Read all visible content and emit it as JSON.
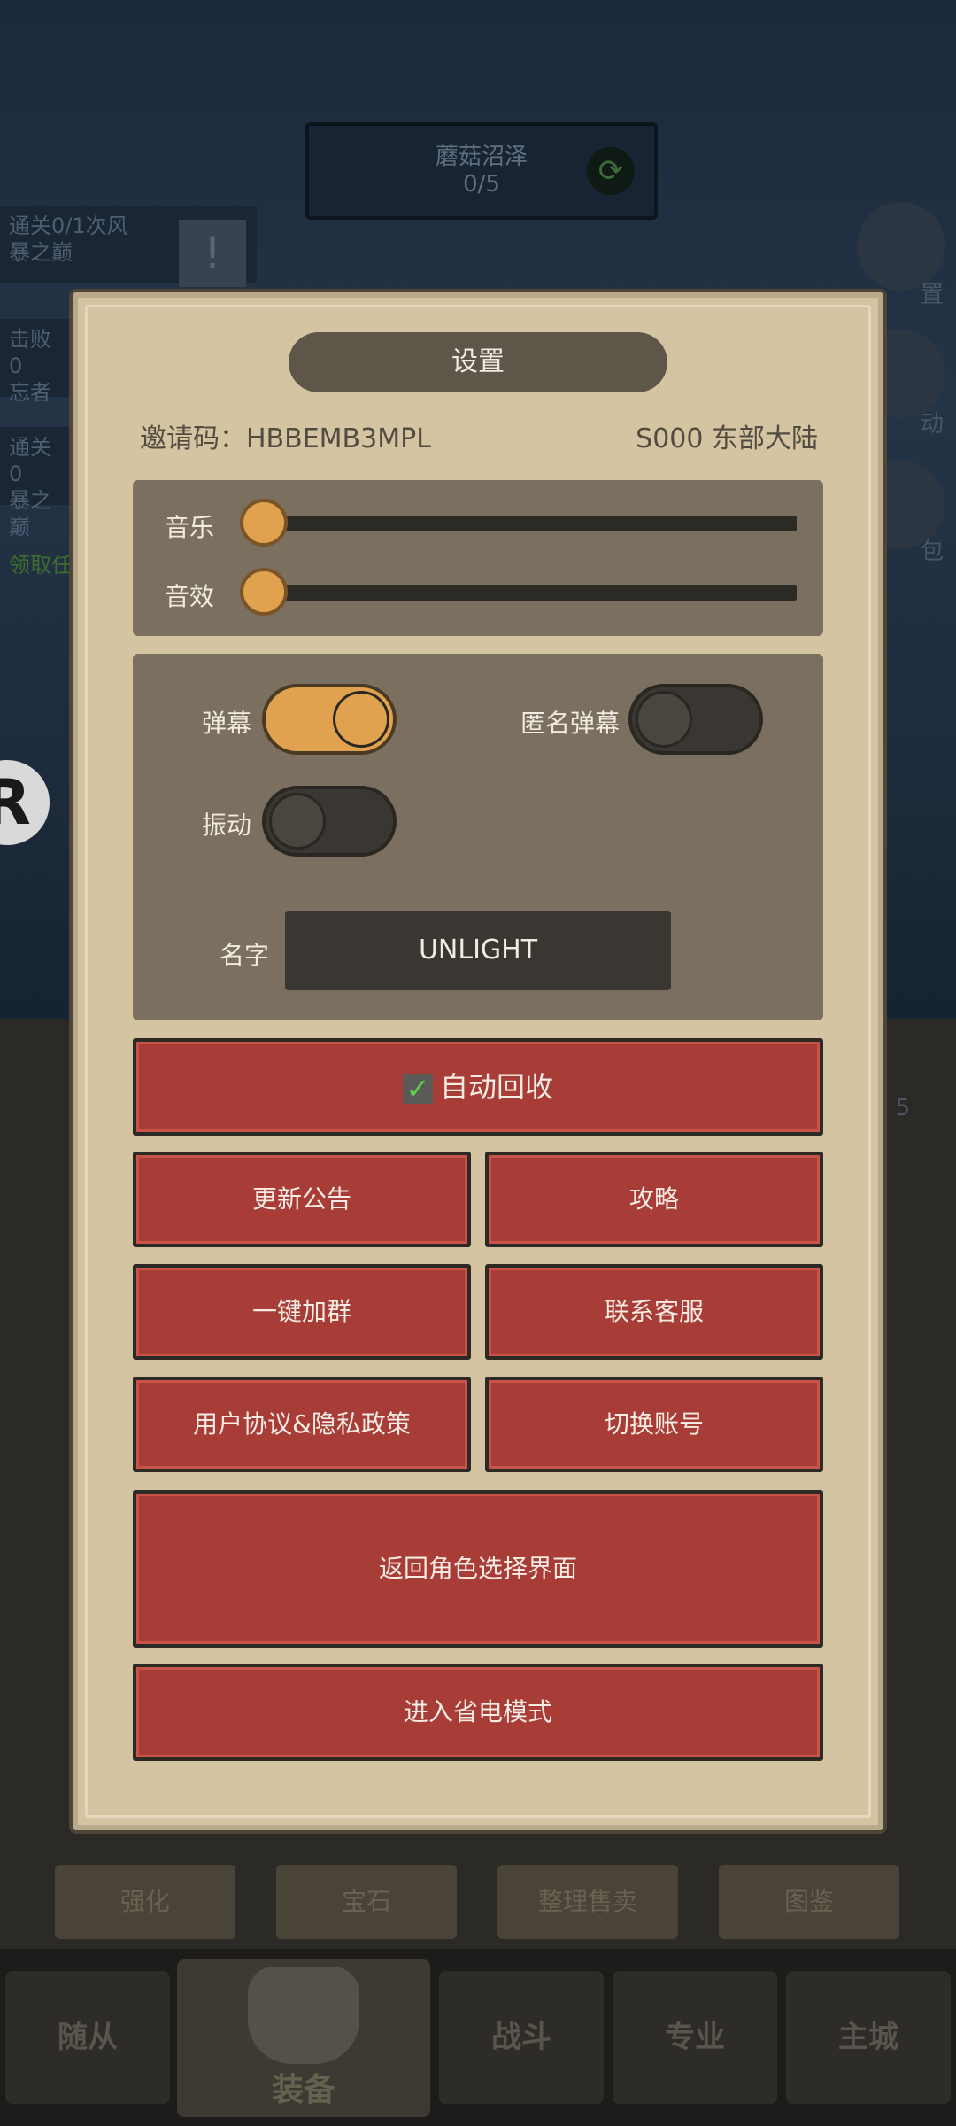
{
  "background": {
    "zone": {
      "name": "蘑菇沼泽",
      "progress": "0/5"
    },
    "quests": [
      {
        "line1": "通关0/1次风",
        "line2": "暴之巅"
      },
      {
        "line1": "击败0",
        "line2": "忘者"
      },
      {
        "line1": "通关0",
        "line2": "暴之巅"
      }
    ],
    "quest_claim": "领取任",
    "right_labels": [
      "置",
      "动",
      "包"
    ],
    "side_number": "5",
    "tabs": [
      "强化",
      "宝石",
      "整理售卖",
      "图鉴"
    ],
    "nav": [
      "随从",
      "装备",
      "战斗",
      "专业",
      "主城"
    ]
  },
  "settings": {
    "title": "设置",
    "invite": "邀请码：HBBEMB3MPL",
    "server": "S000 东部大陆",
    "music_label": "音乐",
    "music_level": 0,
    "sfx_label": "音效",
    "sfx_level": 0,
    "barrage_label": "弹幕",
    "barrage_on": true,
    "anon_barrage_label": "匿名弹幕",
    "anon_barrage_on": false,
    "vibrate_label": "振动",
    "vibrate_on": false,
    "name_label": "名字",
    "name_value": "UNLIGHT",
    "auto_recycle_label": "自动回收",
    "auto_recycle_checked": true,
    "buttons": {
      "update_notice": "更新公告",
      "guide": "攻略",
      "join_group": "一键加群",
      "contact_service": "联系客服",
      "agreement": "用户协议&隐私政策",
      "switch_account": "切换账号",
      "back_to_character": "返回角色选择界面",
      "power_save": "进入省电模式"
    }
  }
}
